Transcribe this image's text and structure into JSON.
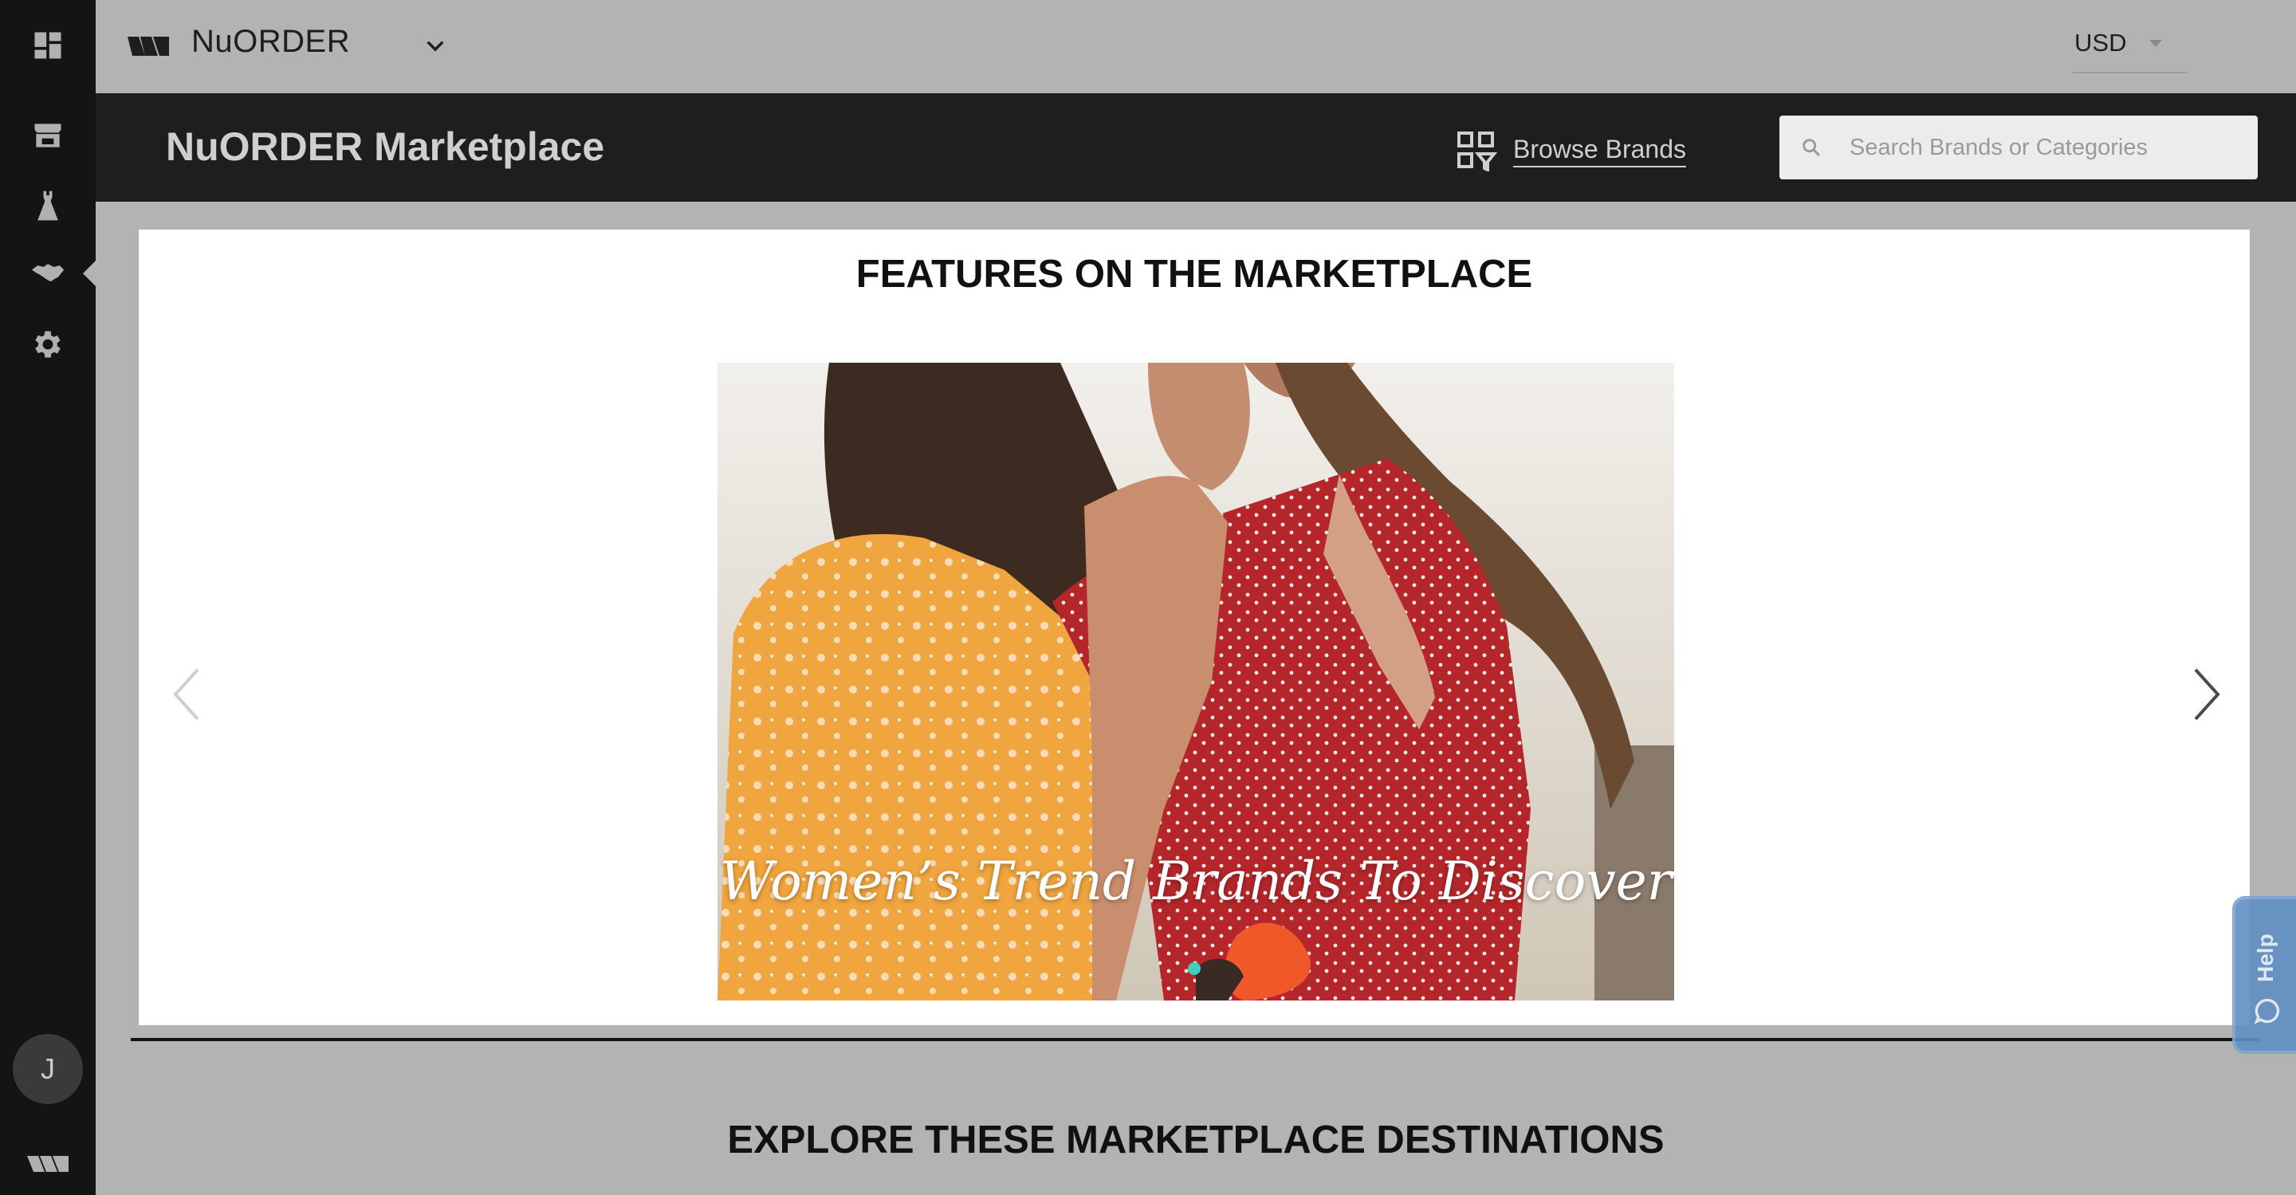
{
  "sidebar": {
    "items": [
      {
        "icon": "dashboard-icon"
      },
      {
        "icon": "storefront-icon"
      },
      {
        "icon": "dress-icon"
      },
      {
        "icon": "handshake-icon"
      },
      {
        "icon": "gear-icon"
      }
    ],
    "avatar_initial": "J",
    "logo_icon": "nuorder-logo-icon"
  },
  "topbar": {
    "company_name": "NuORDER",
    "currency": "USD"
  },
  "header": {
    "title": "NuORDER Marketplace",
    "browse_label": "Browse Brands",
    "search_placeholder": "Search Brands or Categories"
  },
  "features": {
    "heading": "FEATURES ON THE MARKETPLACE",
    "slides": [
      {
        "caption": "Women’s Trend Brands To Discover"
      }
    ],
    "active_slide": 1
  },
  "explore": {
    "heading": "EXPLORE THESE MARKETPLACE DESTINATIONS"
  },
  "help": {
    "label": "Help"
  },
  "colors": {
    "sidebar_bg": "#141414",
    "header_bg": "#1e1e1e",
    "page_bg": "#b3b3b3",
    "accent_dot": "#3fcfc2",
    "help_bg": "#5f8fc4"
  }
}
